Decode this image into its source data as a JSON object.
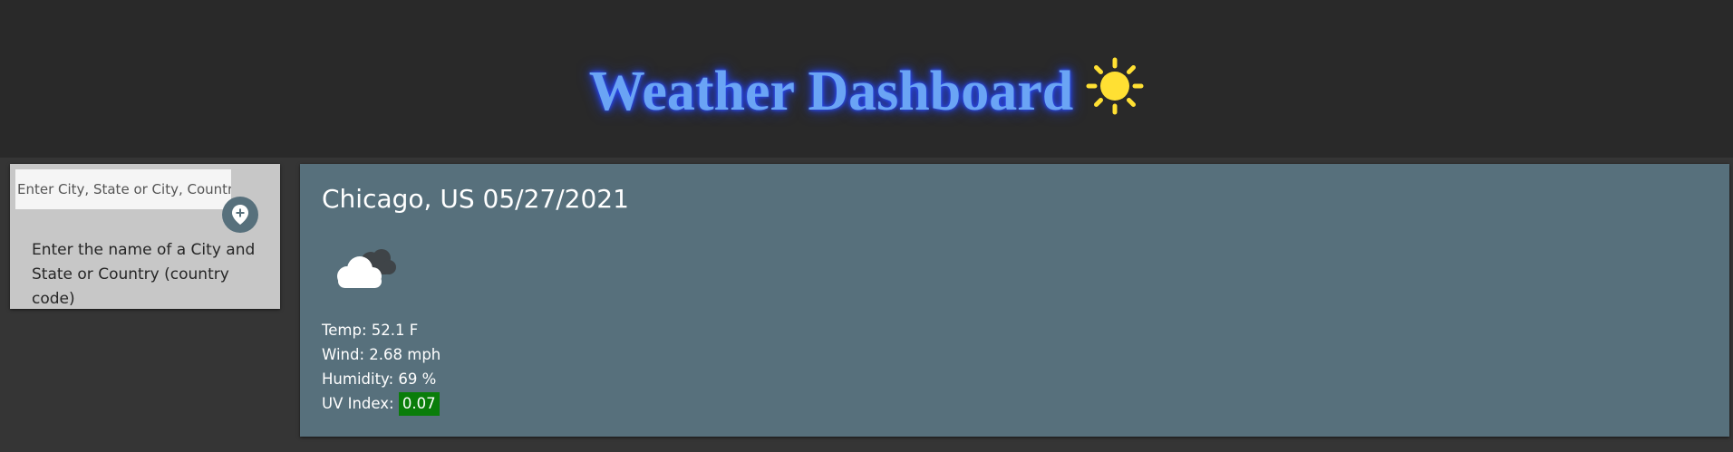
{
  "header": {
    "title": "Weather Dashboard",
    "icon": "sun-icon"
  },
  "search": {
    "placeholder": "Enter City, State or City, Country",
    "value": "",
    "button_icon": "map-pin-plus-icon",
    "help_text": "Enter the name of a City and State or Country (country code)"
  },
  "current": {
    "city_date": "Chicago, US 05/27/2021",
    "weather_icon": "cloud-icon",
    "temp": "Temp: 52.1 F",
    "wind": "Wind: 2.68 mph",
    "humidity": "Humidity: 69 %",
    "uv_label": "UV Index:",
    "uv_value": "0.07"
  },
  "colors": {
    "header_bg": "#292929",
    "page_bg": "#353535",
    "title": "#6aa4f5",
    "title_glow": "#2c4cff",
    "card_bg": "#57707c",
    "panel_bg": "#c7c7c7",
    "uv_low": "#0a7d0a",
    "sun": "#ffe033"
  }
}
